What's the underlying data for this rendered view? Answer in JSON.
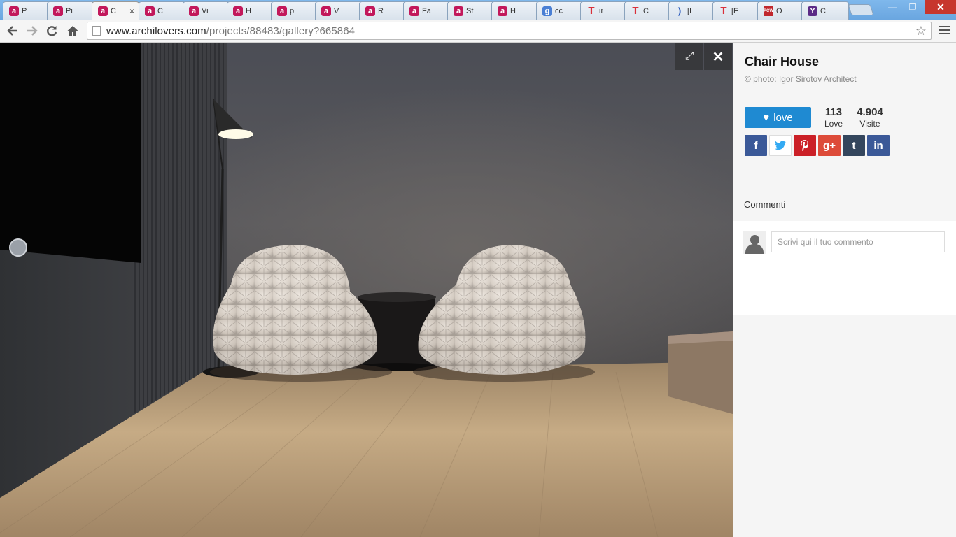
{
  "browser": {
    "tabs": [
      {
        "icon": "a",
        "icon_type": "archilovers",
        "label": "P"
      },
      {
        "icon": "a",
        "icon_type": "archilovers",
        "label": "Pi"
      },
      {
        "icon": "a",
        "icon_type": "archilovers",
        "label": "C",
        "active": true
      },
      {
        "icon": "a",
        "icon_type": "archilovers",
        "label": "C"
      },
      {
        "icon": "a",
        "icon_type": "archilovers",
        "label": "Vi"
      },
      {
        "icon": "a",
        "icon_type": "archilovers",
        "label": "H"
      },
      {
        "icon": "a",
        "icon_type": "archilovers",
        "label": "p"
      },
      {
        "icon": "a",
        "icon_type": "archilovers",
        "label": "V"
      },
      {
        "icon": "a",
        "icon_type": "archilovers",
        "label": "R"
      },
      {
        "icon": "a",
        "icon_type": "archilovers",
        "label": "Fa"
      },
      {
        "icon": "a",
        "icon_type": "archilovers",
        "label": "St"
      },
      {
        "icon": "a",
        "icon_type": "archilovers",
        "label": "H"
      },
      {
        "icon": "g",
        "icon_type": "google",
        "label": "cc"
      },
      {
        "icon": "T",
        "icon_type": "t-red",
        "label": "ir"
      },
      {
        "icon": "T",
        "icon_type": "t-red",
        "label": "C"
      },
      {
        "icon": ")",
        "icon_type": "moon",
        "label": "[I"
      },
      {
        "icon": "T",
        "icon_type": "t-red",
        "label": "[F"
      },
      {
        "icon": "PCW",
        "icon_type": "pcw",
        "label": "O"
      },
      {
        "icon": "Y",
        "icon_type": "yahoo",
        "label": "C"
      }
    ],
    "active_tab_close": "×",
    "window_buttons": {
      "minimize": "—",
      "restore": "❐",
      "close": "✕"
    },
    "url_host": "www.archilovers.com",
    "url_path": "/projects/88483/gallery?665864",
    "nav_icons": {
      "back": "back-arrow-icon",
      "forward": "forward-arrow-icon",
      "reload": "reload-icon",
      "home": "home-icon"
    }
  },
  "viewer": {
    "expand_icon": "⤢",
    "close_icon": "✕"
  },
  "sidebar": {
    "title": "Chair House",
    "credit": "© photo: Igor Sirotov Architect",
    "love_button": "love",
    "love_count": "113",
    "love_count_label": "Love",
    "visits_count": "4.904",
    "visits_label": "Visite",
    "socials": [
      {
        "name": "facebook",
        "glyph": "f"
      },
      {
        "name": "twitter",
        "glyph": "t"
      },
      {
        "name": "pinterest",
        "glyph": "P"
      },
      {
        "name": "google-plus",
        "glyph": "g+"
      },
      {
        "name": "tumblr",
        "glyph": "t"
      },
      {
        "name": "linkedin",
        "glyph": "in"
      }
    ],
    "comments_label": "Commenti",
    "comment_placeholder": "Scrivi qui il tuo commento"
  },
  "colors": {
    "accent": "#1f8ad2",
    "archilovers_brand": "#c2185b"
  }
}
